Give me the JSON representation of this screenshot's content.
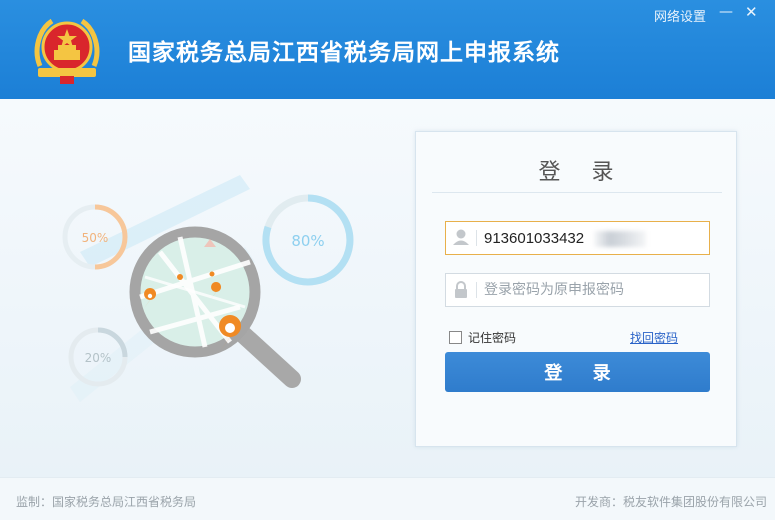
{
  "header": {
    "title": "国家税务总局江西省税务局网上申报系统",
    "network_settings": "网络设置",
    "minimize": "—",
    "close": "✕"
  },
  "illustration": {
    "gauge_left_top": "50%",
    "gauge_right": "80%",
    "gauge_left_bottom": "20%"
  },
  "login": {
    "title": "登 录",
    "username_value": "913601033432",
    "password_placeholder": "登录密码为原申报密码",
    "remember_label": "记住密码",
    "forgot_link": "找回密码",
    "submit_label": "登 录"
  },
  "footer": {
    "supervisor": "监制：国家税务总局江西省税务局",
    "developer": "开发商：税友软件集团股份有限公司"
  },
  "colors": {
    "header_blue": "#1c7fd6",
    "button_blue": "#2f7ccc",
    "accent_orange": "#f08a24"
  }
}
